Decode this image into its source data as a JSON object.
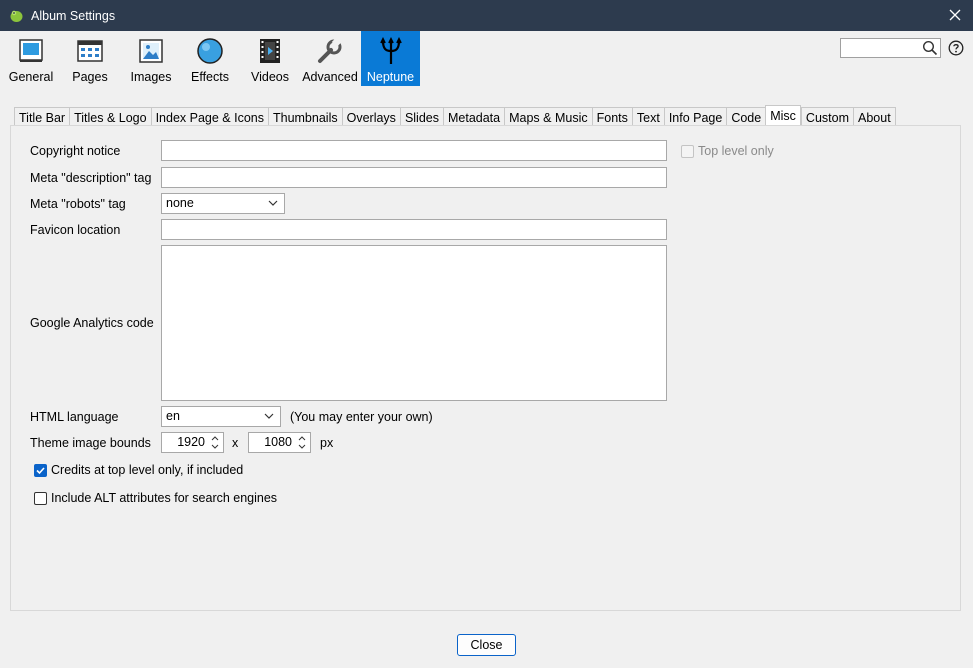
{
  "window": {
    "title": "Album Settings",
    "accent": "#0a7ad6",
    "titlebar_color": "#2d3b4e"
  },
  "toolbar": {
    "items": [
      {
        "label": "General",
        "icon": "general-icon"
      },
      {
        "label": "Pages",
        "icon": "pages-icon"
      },
      {
        "label": "Images",
        "icon": "images-icon"
      },
      {
        "label": "Effects",
        "icon": "effects-icon"
      },
      {
        "label": "Videos",
        "icon": "videos-icon"
      },
      {
        "label": "Advanced",
        "icon": "advanced-icon"
      },
      {
        "label": "Neptune",
        "icon": "trident-icon",
        "active": true
      }
    ],
    "search_value": ""
  },
  "tabs": [
    {
      "label": "Title Bar"
    },
    {
      "label": "Titles & Logo"
    },
    {
      "label": "Index Page & Icons"
    },
    {
      "label": "Thumbnails"
    },
    {
      "label": "Overlays"
    },
    {
      "label": "Slides"
    },
    {
      "label": "Metadata"
    },
    {
      "label": "Maps & Music"
    },
    {
      "label": "Fonts"
    },
    {
      "label": "Text"
    },
    {
      "label": "Info Page"
    },
    {
      "label": "Code"
    },
    {
      "label": "Misc",
      "active": true
    },
    {
      "label": "Custom"
    },
    {
      "label": "About"
    }
  ],
  "form": {
    "copyright_label": "Copyright notice",
    "copyright_value": "",
    "top_level_only_label": "Top level only",
    "top_level_only_checked": false,
    "meta_description_label": "Meta \"description\" tag",
    "meta_description_value": "",
    "meta_robots_label": "Meta \"robots\" tag",
    "meta_robots_value": "none",
    "favicon_label": "Favicon location",
    "favicon_value": "",
    "analytics_label": "Google Analytics code",
    "analytics_value": "",
    "html_language_label": "HTML language",
    "html_language_value": "en",
    "html_language_hint": "(You may enter your own)",
    "bounds_label": "Theme image bounds",
    "bounds_width": "1920",
    "bounds_x": "x",
    "bounds_height": "1080",
    "bounds_unit": "px",
    "credits_label": "Credits at top level only, if included",
    "credits_checked": true,
    "alt_label": "Include ALT attributes for search engines",
    "alt_checked": false
  },
  "footer": {
    "close_label": "Close"
  }
}
